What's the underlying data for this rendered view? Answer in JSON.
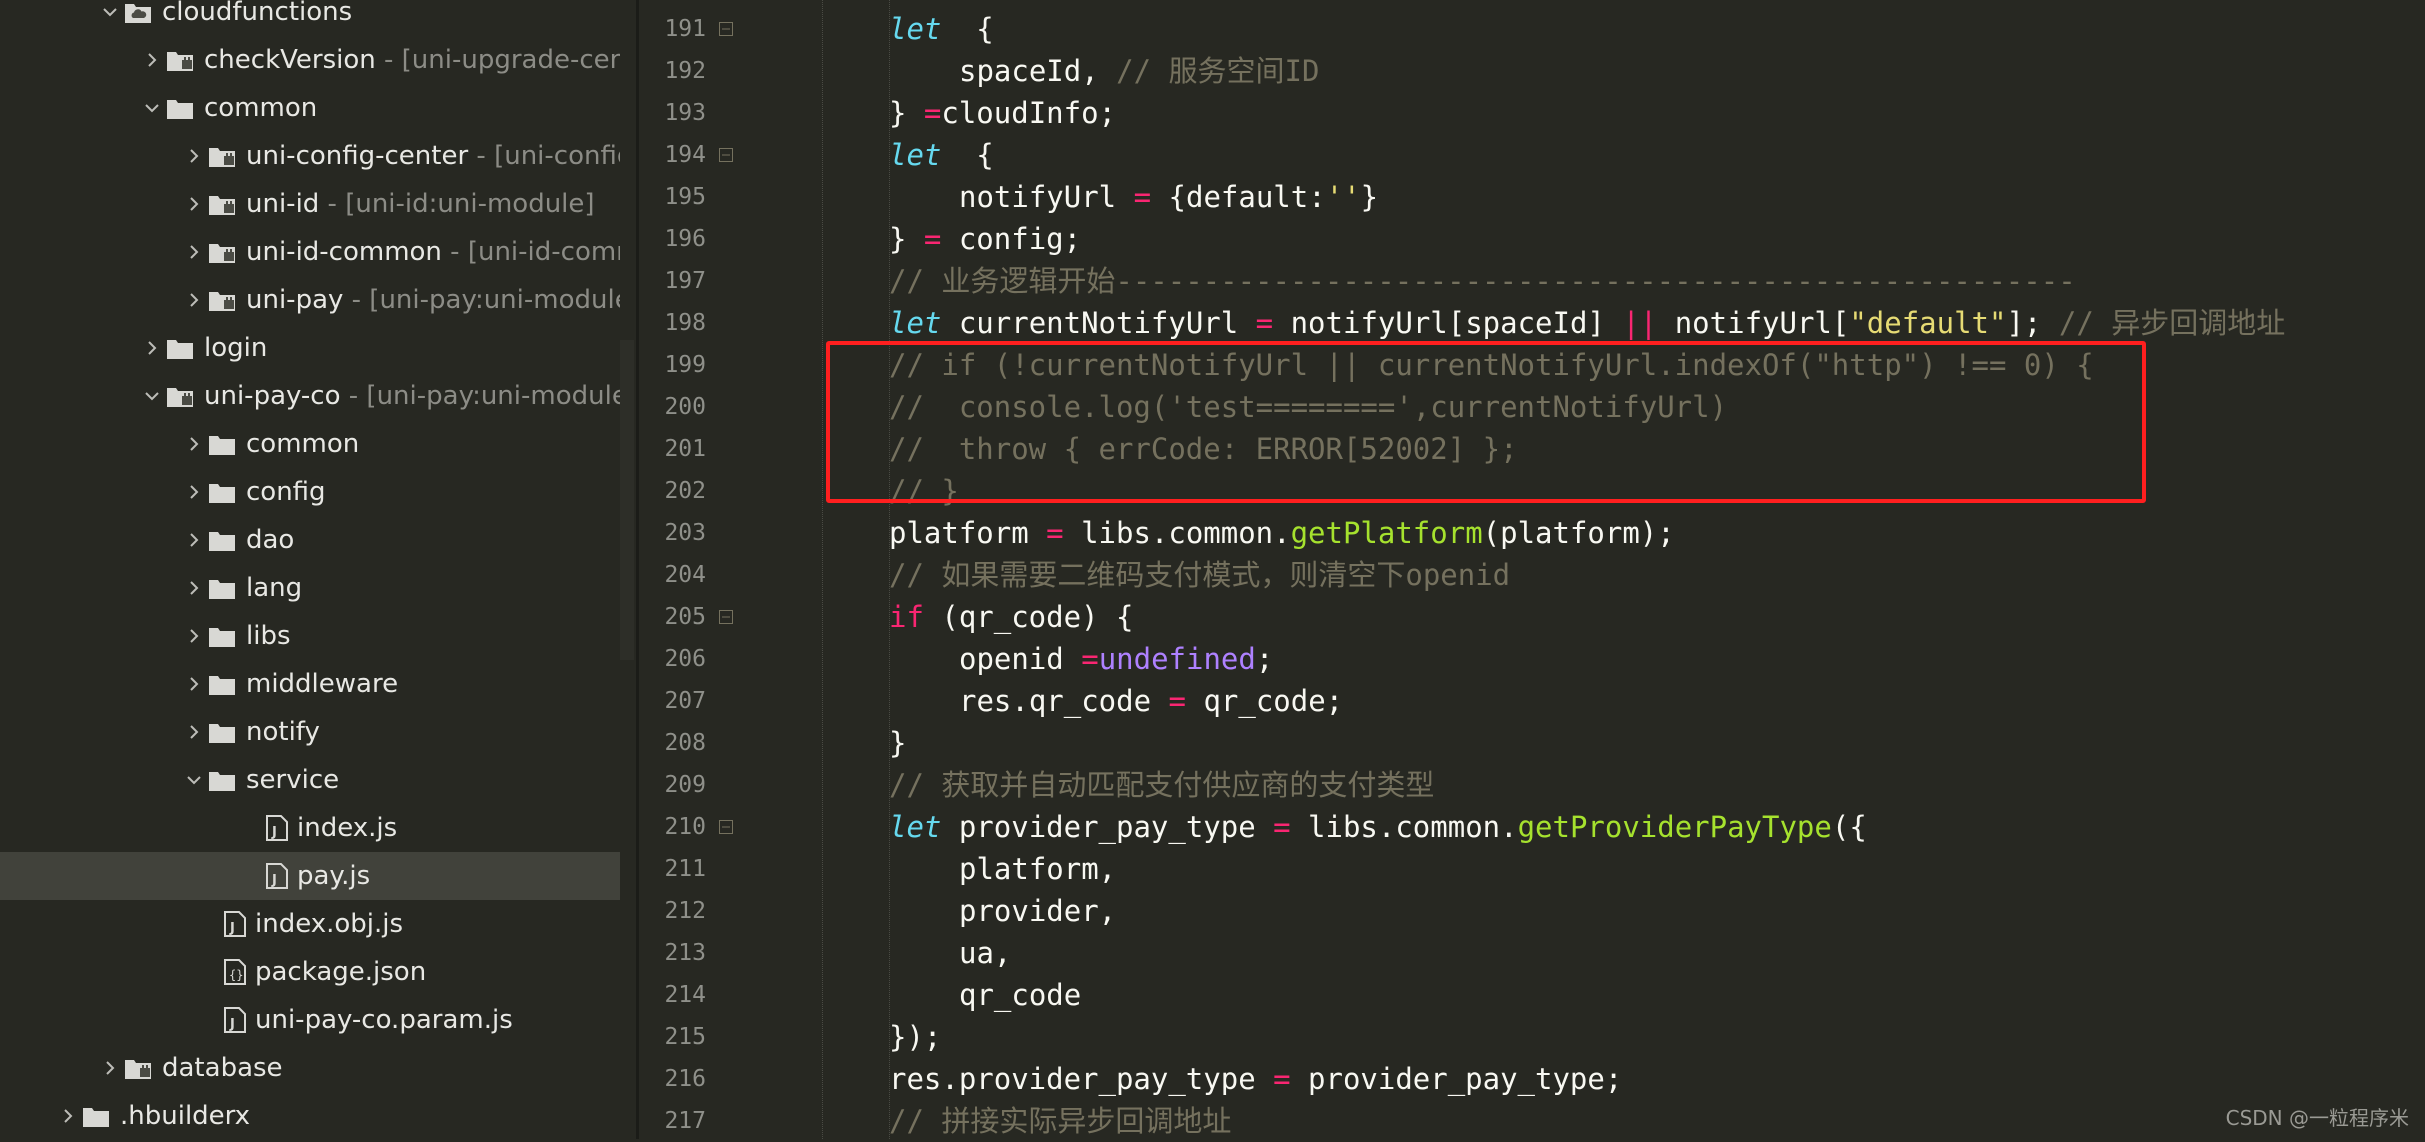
{
  "sidebar": {
    "items": [
      {
        "name": "cloudfunctions",
        "desc": "",
        "type": "folder",
        "open": true,
        "level": 1
      },
      {
        "name": "checkVersion",
        "desc": " - [uni-upgrade-center-ap",
        "type": "module",
        "open": false,
        "level": 2
      },
      {
        "name": "common",
        "desc": "",
        "type": "folder",
        "open": true,
        "level": 2
      },
      {
        "name": "uni-config-center",
        "desc": " - [uni-config-cent",
        "type": "module",
        "open": false,
        "level": 3
      },
      {
        "name": "uni-id",
        "desc": " - [uni-id:uni-module]",
        "type": "module",
        "open": false,
        "level": 3
      },
      {
        "name": "uni-id-common",
        "desc": " - [uni-id-common:u",
        "type": "module",
        "open": false,
        "level": 3
      },
      {
        "name": "uni-pay",
        "desc": " - [uni-pay:uni-module]",
        "type": "module",
        "open": false,
        "level": 3
      },
      {
        "name": "login",
        "desc": "",
        "type": "folder",
        "open": false,
        "level": 2
      },
      {
        "name": "uni-pay-co",
        "desc": " - [uni-pay:uni-module]",
        "type": "module",
        "open": true,
        "level": 2
      },
      {
        "name": "common",
        "desc": "",
        "type": "folder",
        "open": false,
        "level": 3
      },
      {
        "name": "config",
        "desc": "",
        "type": "folder",
        "open": false,
        "level": 3
      },
      {
        "name": "dao",
        "desc": "",
        "type": "folder",
        "open": false,
        "level": 3
      },
      {
        "name": "lang",
        "desc": "",
        "type": "folder",
        "open": false,
        "level": 3
      },
      {
        "name": "libs",
        "desc": "",
        "type": "folder",
        "open": false,
        "level": 3
      },
      {
        "name": "middleware",
        "desc": "",
        "type": "folder",
        "open": false,
        "level": 3
      },
      {
        "name": "notify",
        "desc": "",
        "type": "folder",
        "open": false,
        "level": 3
      },
      {
        "name": "service",
        "desc": "",
        "type": "folder",
        "open": true,
        "level": 3
      },
      {
        "name": "index.js",
        "desc": "",
        "type": "file-js",
        "level": 4
      },
      {
        "name": "pay.js",
        "desc": "",
        "type": "file-js",
        "level": 4,
        "selected": true
      },
      {
        "name": "index.obj.js",
        "desc": "",
        "type": "file-js",
        "level": 3
      },
      {
        "name": "package.json",
        "desc": "",
        "type": "file-json",
        "level": 3
      },
      {
        "name": "uni-pay-co.param.js",
        "desc": "",
        "type": "file-js",
        "level": 3
      },
      {
        "name": "database",
        "desc": "",
        "type": "module",
        "open": false,
        "level": 1
      },
      {
        "name": ".hbuilderx",
        "desc": "",
        "type": "folder",
        "open": false,
        "level": 0
      }
    ]
  },
  "editor": {
    "lines": [
      {
        "n": "191",
        "fold": true,
        "tokens": [
          [
            "kw",
            "let"
          ],
          [
            "",
            "  {"
          ]
        ]
      },
      {
        "n": "192",
        "indent": 1,
        "tokens": [
          [
            "",
            "spaceId, "
          ],
          [
            "cm",
            "// 服务空间ID"
          ]
        ]
      },
      {
        "n": "193",
        "tokens": [
          [
            "",
            "} "
          ],
          [
            "op",
            "="
          ],
          [
            "",
            "",
            " "
          ],
          [
            "",
            "cloudInfo;"
          ]
        ]
      },
      {
        "n": "194",
        "fold": true,
        "tokens": [
          [
            "kw",
            "let"
          ],
          [
            "",
            "  {"
          ]
        ]
      },
      {
        "n": "195",
        "indent": 1,
        "tokens": [
          [
            "",
            "notifyUrl "
          ],
          [
            "op",
            "="
          ],
          [
            "",
            " {default:"
          ],
          [
            "st",
            "''"
          ],
          [
            "",
            "}"
          ]
        ]
      },
      {
        "n": "196",
        "tokens": [
          [
            "",
            "} "
          ],
          [
            "op",
            "="
          ],
          [
            "",
            " config;"
          ]
        ]
      },
      {
        "n": "197",
        "tokens": [
          [
            "cm",
            "// 业务逻辑开始-------------------------------------------------------"
          ]
        ]
      },
      {
        "n": "198",
        "tokens": [
          [
            "kw",
            "let"
          ],
          [
            "",
            " currentNotifyUrl "
          ],
          [
            "op",
            "="
          ],
          [
            "",
            " notifyUrl[spaceId] "
          ],
          [
            "op",
            "||"
          ],
          [
            "",
            " notifyUrl["
          ],
          [
            "st",
            "\"default\""
          ],
          [
            "",
            "]; "
          ],
          [
            "cm",
            "// 异步回调地址"
          ]
        ]
      },
      {
        "n": "199",
        "tokens": [
          [
            "cm",
            "// if (!currentNotifyUrl || currentNotifyUrl.indexOf(\"http\") !== 0) {"
          ]
        ]
      },
      {
        "n": "200",
        "tokens": [
          [
            "cm",
            "//  console.log('test========',currentNotifyUrl)"
          ]
        ]
      },
      {
        "n": "201",
        "tokens": [
          [
            "cm",
            "//  throw { errCode: ERROR[52002] };"
          ]
        ]
      },
      {
        "n": "202",
        "tokens": [
          [
            "cm",
            "// }"
          ]
        ]
      },
      {
        "n": "203",
        "tokens": [
          [
            "",
            "platform "
          ],
          [
            "op",
            "="
          ],
          [
            "",
            " libs.common."
          ],
          [
            "fn",
            "getPlatform"
          ],
          [
            "",
            "(platform);"
          ]
        ]
      },
      {
        "n": "204",
        "tokens": [
          [
            "cm",
            "// 如果需要二维码支付模式，则清空下openid"
          ]
        ]
      },
      {
        "n": "205",
        "fold": true,
        "tokens": [
          [
            "kw2",
            "if"
          ],
          [
            "",
            " (qr_code) {"
          ]
        ]
      },
      {
        "n": "206",
        "indent": 1,
        "tokens": [
          [
            "",
            "openid "
          ],
          [
            "op",
            "="
          ],
          [
            " ",
            ""
          ],
          [
            "cn",
            "undefined"
          ],
          [
            "",
            ";"
          ]
        ]
      },
      {
        "n": "207",
        "indent": 1,
        "tokens": [
          [
            "",
            "res.qr_code "
          ],
          [
            "op",
            "="
          ],
          [
            "",
            " qr_code;"
          ]
        ]
      },
      {
        "n": "208",
        "tokens": [
          [
            "",
            "}"
          ]
        ]
      },
      {
        "n": "209",
        "tokens": [
          [
            "cm",
            "// 获取并自动匹配支付供应商的支付类型"
          ]
        ]
      },
      {
        "n": "210",
        "fold": true,
        "tokens": [
          [
            "kw",
            "let"
          ],
          [
            "",
            " provider_pay_type "
          ],
          [
            "op",
            "="
          ],
          [
            "",
            " libs.common."
          ],
          [
            "fn",
            "getProviderPayType"
          ],
          [
            "",
            "({"
          ]
        ]
      },
      {
        "n": "211",
        "indent": 1,
        "tokens": [
          [
            "",
            "platform,"
          ]
        ]
      },
      {
        "n": "212",
        "indent": 1,
        "tokens": [
          [
            "",
            "provider,"
          ]
        ]
      },
      {
        "n": "213",
        "indent": 1,
        "tokens": [
          [
            "",
            "ua,"
          ]
        ]
      },
      {
        "n": "214",
        "indent": 1,
        "tokens": [
          [
            "",
            "qr_code"
          ]
        ]
      },
      {
        "n": "215",
        "tokens": [
          [
            "",
            "});"
          ]
        ]
      },
      {
        "n": "216",
        "tokens": [
          [
            "",
            "res.provider_pay_type "
          ],
          [
            "op",
            "="
          ],
          [
            "",
            " provider_pay_type;"
          ]
        ]
      },
      {
        "n": "217",
        "tokens": [
          [
            "cm",
            "// 拼接实际异步回调地址"
          ]
        ]
      }
    ]
  },
  "watermark": "CSDN @一粒程序米",
  "colors": {
    "background": "#272822",
    "keyword": "#66d9ef",
    "operator": "#f92672",
    "comment": "#75715e",
    "string": "#e6db74",
    "function": "#a6e22e",
    "constant": "#ae81ff",
    "highlight_box": "#ff1f1f"
  }
}
